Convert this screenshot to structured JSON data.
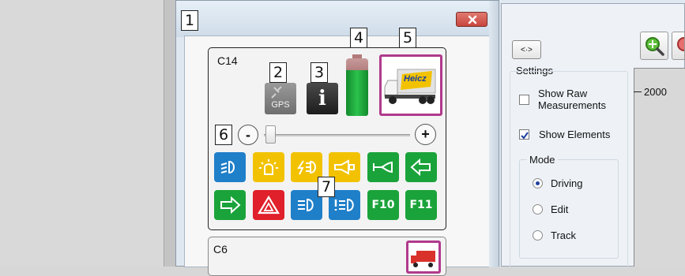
{
  "callouts": [
    "1",
    "2",
    "3",
    "4",
    "5",
    "6",
    "7"
  ],
  "vehicle_panel": {
    "id": "C14",
    "gps_label": "GPS",
    "info_glyph": "i",
    "truck_brand": "Heicz",
    "slider_minus": "-",
    "slider_plus": "+",
    "functions": [
      {
        "icon": "headlight-icon",
        "text": "",
        "color": "#1f7fc9"
      },
      {
        "icon": "beacon-icon",
        "text": "",
        "color": "#f2c200"
      },
      {
        "icon": "flash-light-icon",
        "text": "",
        "color": "#f2c200"
      },
      {
        "icon": "horn-icon",
        "text": "",
        "color": "#f2c200"
      },
      {
        "icon": "horn-icon",
        "text": "",
        "color": "#1aa33a"
      },
      {
        "icon": "arrow-left-icon",
        "text": "",
        "color": "#1aa33a"
      },
      {
        "icon": "arrow-right-icon",
        "text": "",
        "color": "#1aa33a"
      },
      {
        "icon": "hazard-icon",
        "text": "",
        "color": "#e0202a"
      },
      {
        "icon": "low-beam-icon",
        "text": "",
        "color": "#1f7fc9"
      },
      {
        "icon": "fog-light-icon",
        "text": "",
        "color": "#1f7fc9"
      },
      {
        "icon": "function-f10-icon",
        "text": "F10",
        "color": "#1aa33a"
      },
      {
        "icon": "function-f11-icon",
        "text": "F11",
        "color": "#1aa33a"
      }
    ]
  },
  "second_panel": {
    "id": "C6"
  },
  "toolbar": {
    "toggle_label": "<·>"
  },
  "settings": {
    "title": "Settings",
    "show_raw": {
      "label_line1": "Show Raw",
      "label_line2": "Measurements",
      "checked": false
    },
    "show_elements": {
      "label": "Show Elements",
      "checked": true
    },
    "mode": {
      "title": "Mode",
      "options": [
        "Driving",
        "Edit",
        "Track"
      ],
      "selected": "Driving"
    }
  },
  "graph": {
    "tick_label": "2000"
  },
  "colors": {
    "accent_border": "#b03a8c",
    "close_red": "#c9463d",
    "battery_green": "#1aa33a"
  }
}
